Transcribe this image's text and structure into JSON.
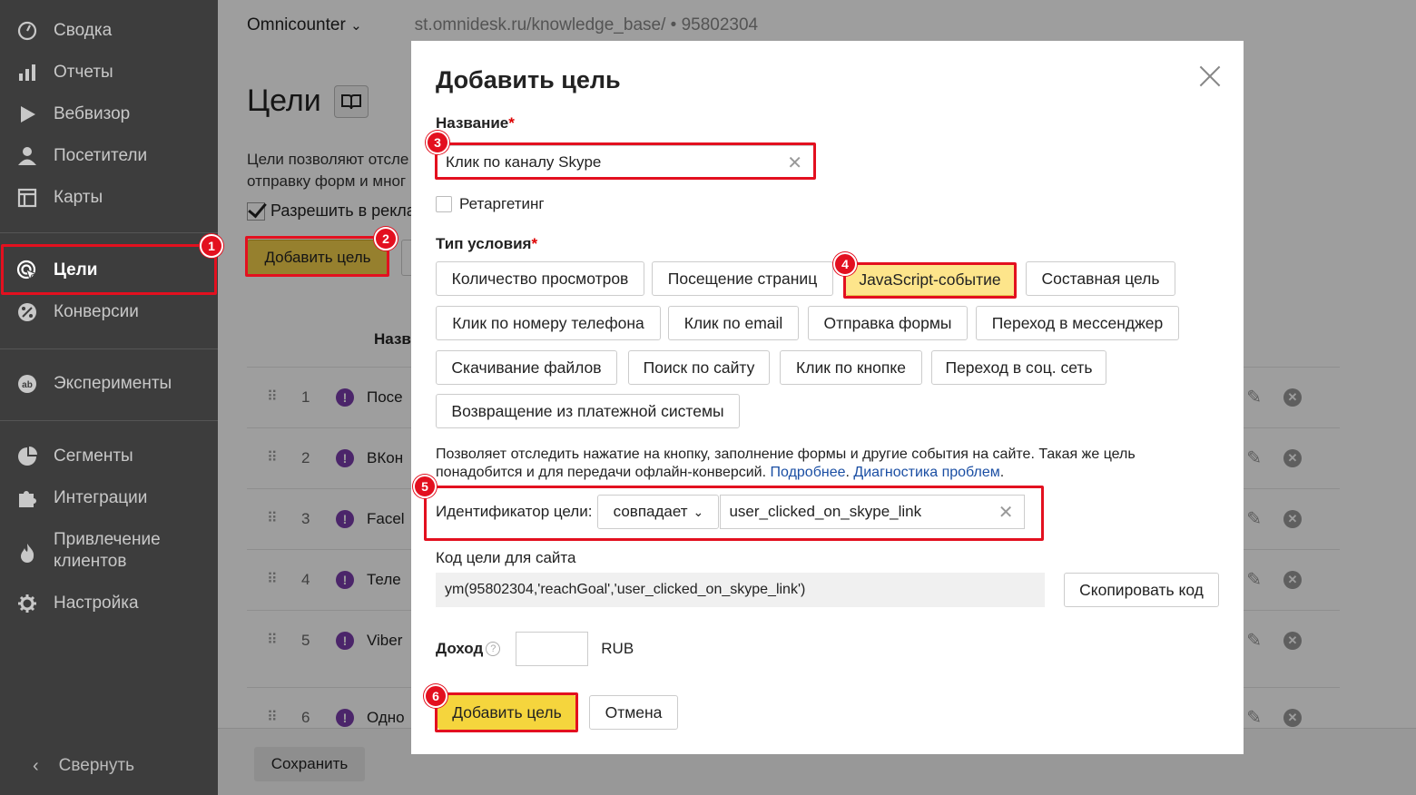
{
  "sidebar": {
    "items": [
      {
        "label": "Сводка",
        "icon": "gauge-icon"
      },
      {
        "label": "Отчеты",
        "icon": "bar-chart-icon"
      },
      {
        "label": "Вебвизор",
        "icon": "play-icon"
      },
      {
        "label": "Посетители",
        "icon": "user-icon"
      },
      {
        "label": "Карты",
        "icon": "map-icon"
      },
      {
        "label": "Цели",
        "icon": "target-cursor-icon"
      },
      {
        "label": "Конверсии",
        "icon": "percent-icon"
      },
      {
        "label": "Эксперименты",
        "icon": "ab-icon"
      },
      {
        "label": "Сегменты",
        "icon": "pie-icon"
      },
      {
        "label": "Интеграции",
        "icon": "puzzle-icon"
      },
      {
        "label": "Привлечение клиентов",
        "icon": "flame-icon"
      },
      {
        "label": "Настройка",
        "icon": "gear-icon"
      }
    ],
    "collapse_label": "Свернуть"
  },
  "topbar": {
    "counter": "Omnicounter",
    "url": "st.omnidesk.ru/knowledge_base/ • 95802304"
  },
  "page": {
    "title": "Цели",
    "desc_line1": "Цели позволяют отсле",
    "desc_line2": "отправку форм и мног",
    "allow_label": "Разрешить в рекла",
    "add_goal_label": "Добавить цель",
    "col_name": "Назв",
    "save_label": "Сохранить"
  },
  "goals": [
    {
      "num": "1",
      "name": "Посе"
    },
    {
      "num": "2",
      "name": "ВКон"
    },
    {
      "num": "3",
      "name": "Facel"
    },
    {
      "num": "4",
      "name": "Теле"
    },
    {
      "num": "5",
      "name": "Viber"
    },
    {
      "num": "6",
      "name": "Одно"
    }
  ],
  "modal": {
    "title": "Добавить цель",
    "name_label": "Название",
    "required_mark": "*",
    "name_value": "Клик по каналу Skype",
    "retarget_label": "Ретаргетинг",
    "condition_label": "Тип условия",
    "condition_types": [
      "Количество просмотров",
      "Посещение страниц",
      "JavaScript-событие",
      "Составная цель",
      "Клик по номеру телефона",
      "Клик по email",
      "Отправка формы",
      "Переход в мессенджер",
      "Скачивание файлов",
      "Поиск по сайту",
      "Клик по кнопке",
      "Переход в соц. сеть",
      "Возвращение из платежной системы"
    ],
    "selected_condition": "JavaScript-событие",
    "info_text": "Позволяет отследить нажатие на кнопку, заполнение формы и другие события на сайте. Такая же цель понадобится и для передачи офлайн-конверсий.",
    "info_link1": "Подробнее",
    "info_link2": "Диагностика проблем",
    "ident_label": "Идентификатор цели:",
    "match_value": "совпадает",
    "ident_value": "user_clicked_on_skype_link",
    "code_label": "Код цели для сайта",
    "code_value": "ym(95802304,'reachGoal','user_clicked_on_skype_link')",
    "copy_label": "Скопировать код",
    "income_label": "Доход",
    "currency": "RUB",
    "submit_label": "Добавить цель",
    "cancel_label": "Отмена"
  },
  "annotations": [
    "1",
    "2",
    "3",
    "4",
    "5",
    "6"
  ],
  "colors": {
    "sidebar_bg": "#3d3d3d",
    "accent_yellow": "#f5d53d",
    "selected_yellow": "#fde58b",
    "highlight_red": "#e3101f",
    "link_blue": "#1a4ea3",
    "warn_purple": "#7a3dab"
  }
}
